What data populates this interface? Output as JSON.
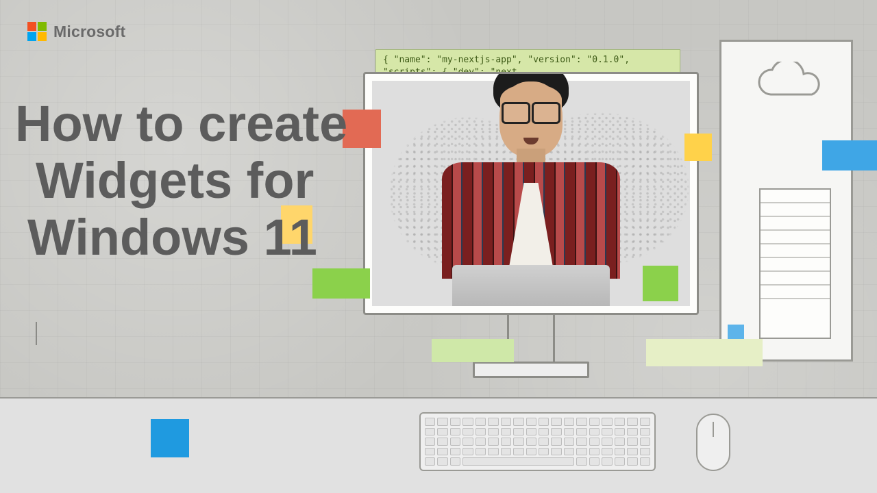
{
  "brand": {
    "name": "Microsoft"
  },
  "headline": {
    "line1": "How to create",
    "line2": "Widgets for",
    "line3": "Windows 11"
  },
  "code_card": {
    "line1": "{ \"name\": \"my-nextjs-app\",  \"version\": \"0.1.0\",",
    "line2": "  \"scripts\": { \"dev\": \"next"
  },
  "accents": {
    "red": "#e26a54",
    "yellow": "#ffd24a",
    "green": "#8bd14b",
    "blue": "#1f9ae0"
  }
}
